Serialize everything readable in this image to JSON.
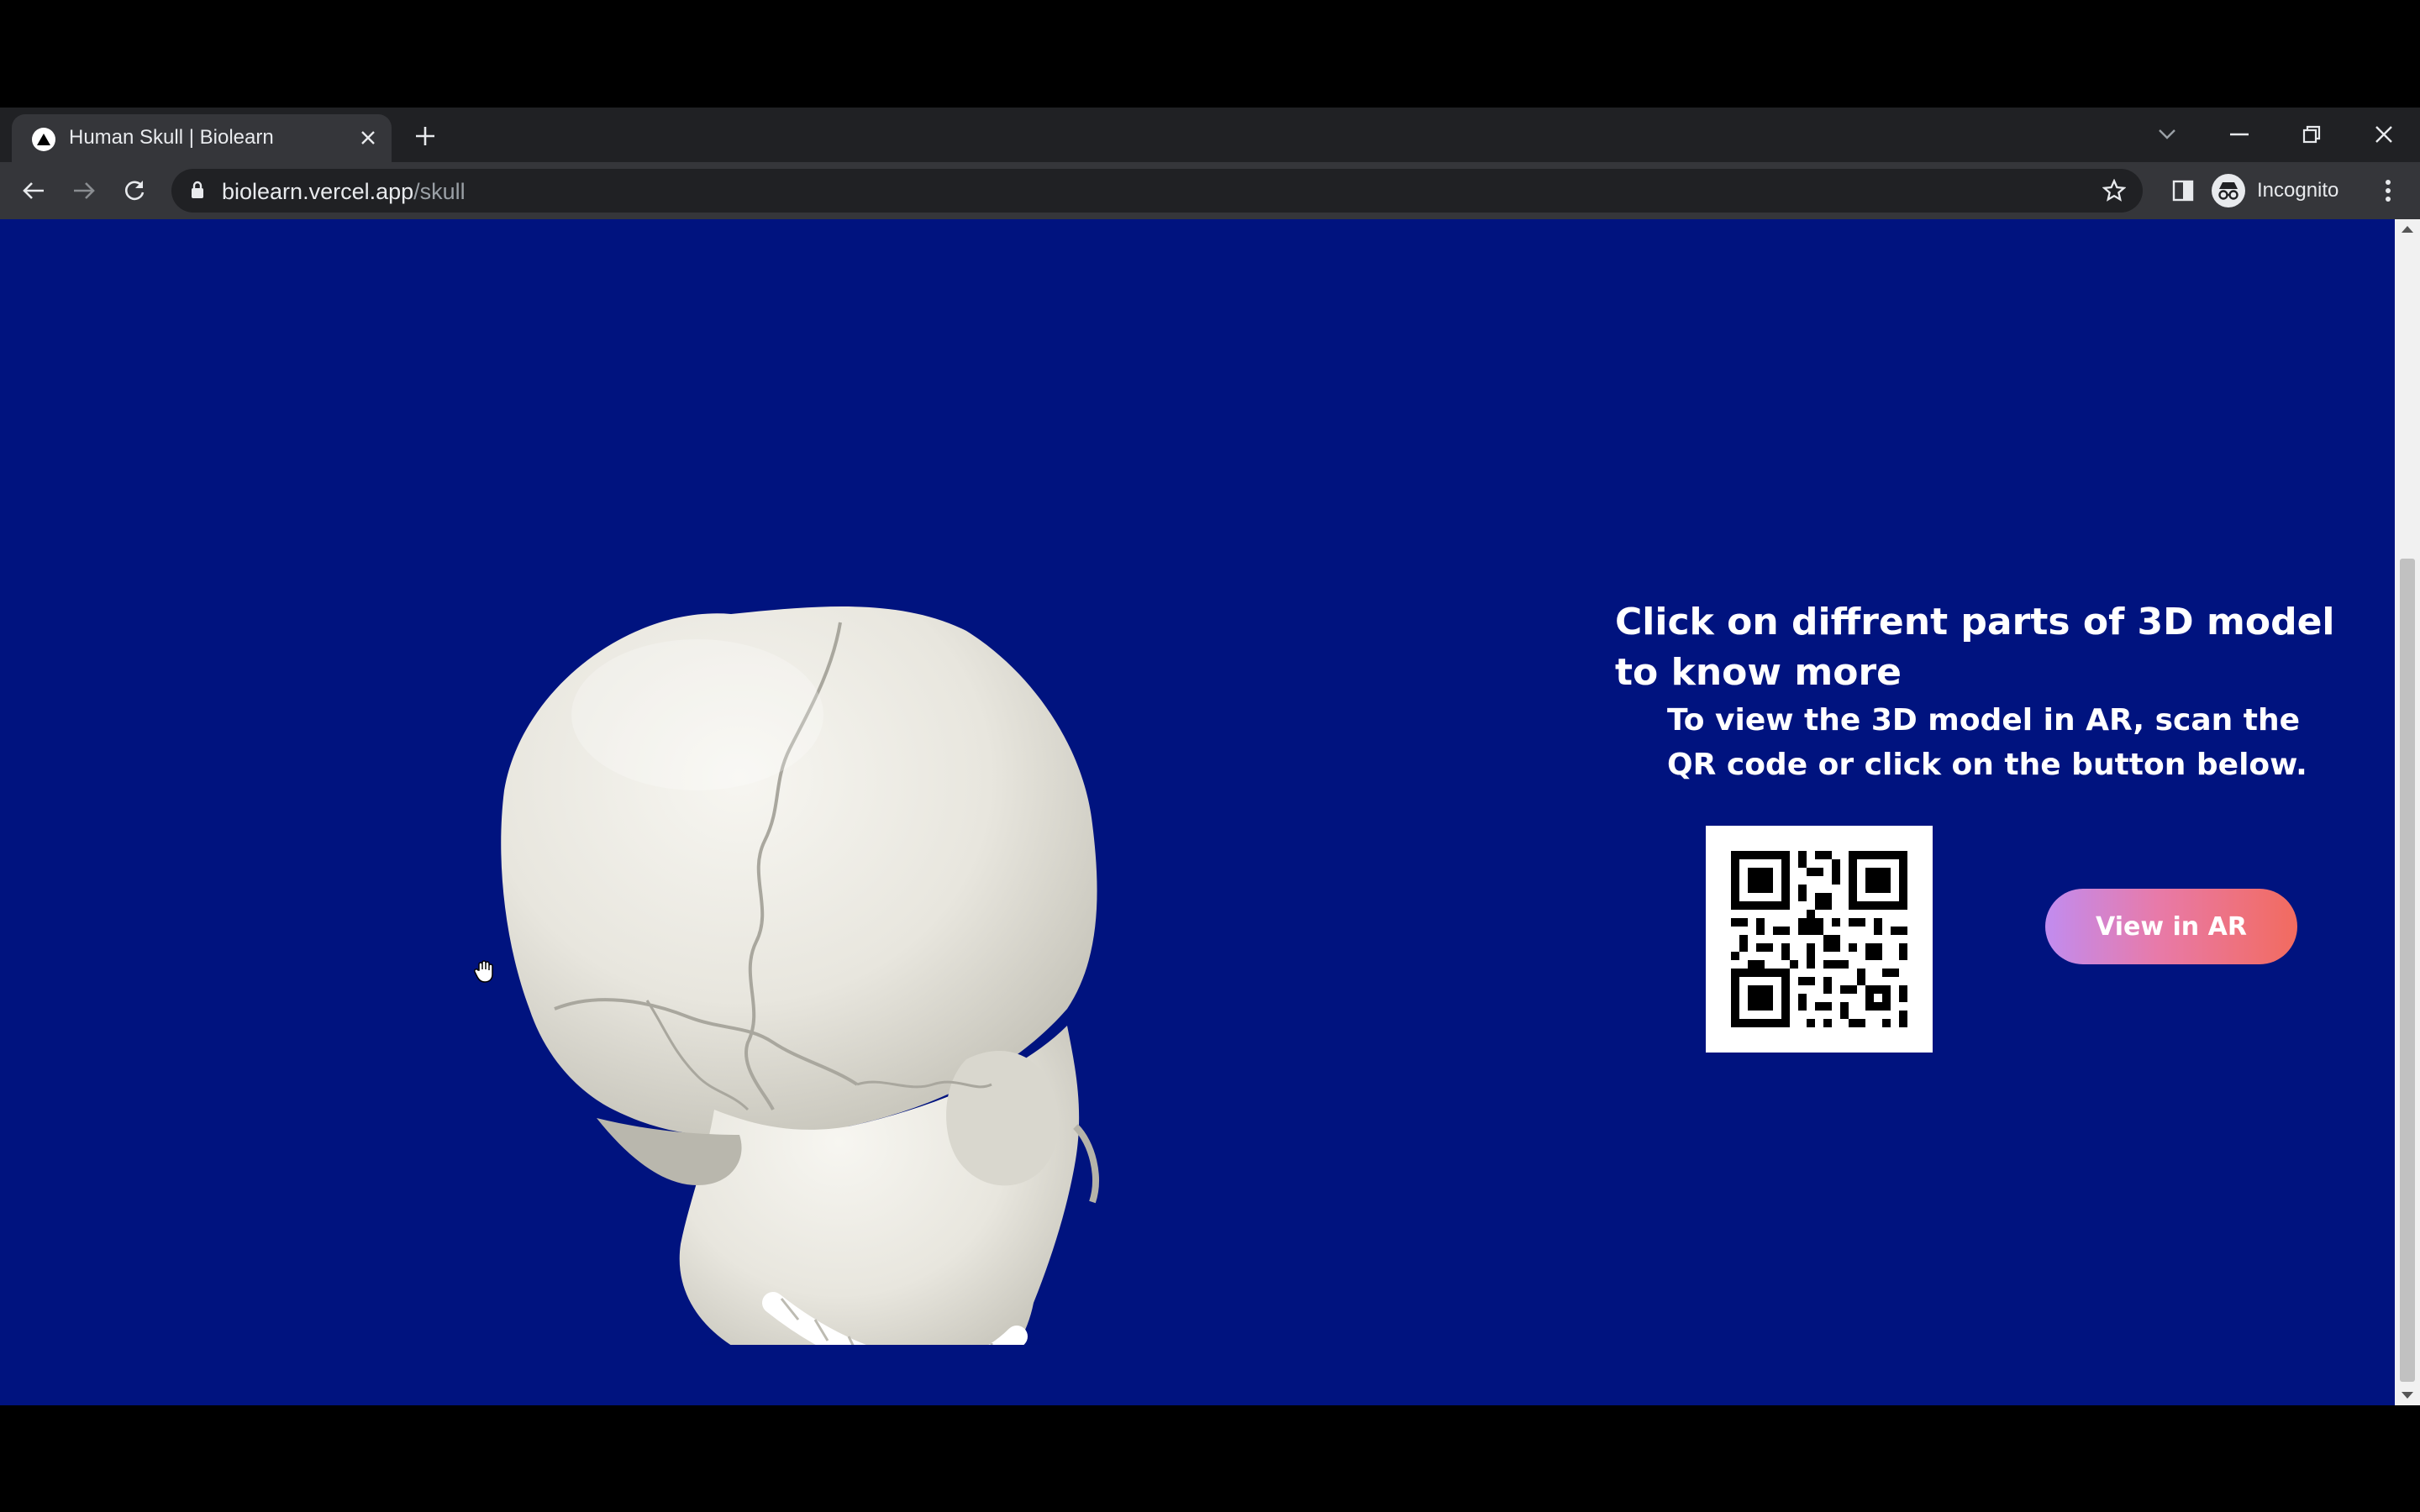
{
  "browser": {
    "tab_title": "Human Skull | Biolearn",
    "url_host": "biolearn.vercel.app",
    "url_path": "/skull",
    "profile_label": "Incognito"
  },
  "page": {
    "background_color": "#00137f",
    "heading": "Click on diffrent parts of 3D model to know more",
    "instructions": "To view the 3D model in AR, scan the QR code or click on the button below.",
    "ar_button_label": "View in AR",
    "model_name": "human-skull-3d-model"
  }
}
